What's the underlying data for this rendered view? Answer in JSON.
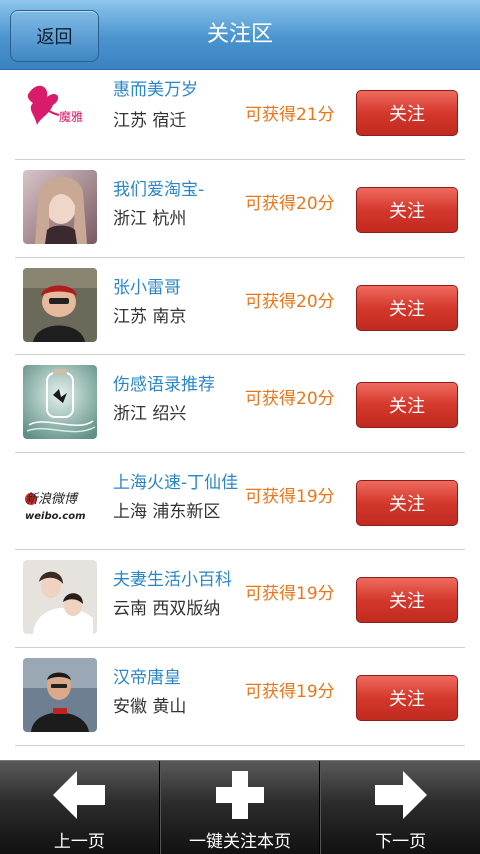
{
  "header": {
    "back_label": "返回",
    "title": "关注区"
  },
  "items": [
    {
      "name": "惠而美万岁",
      "location": "江苏 宿迁",
      "points": "可获得21分",
      "button": "关注",
      "avatar_logo": "魔雅"
    },
    {
      "name": "我们爱淘宝-",
      "location": "浙江 杭州",
      "points": "可获得20分",
      "button": "关注"
    },
    {
      "name": "张小雷哥",
      "location": "江苏 南京",
      "points": "可获得20分",
      "button": "关注"
    },
    {
      "name": "伤感语录推荐",
      "location": "浙江 绍兴",
      "points": "可获得20分",
      "button": "关注"
    },
    {
      "name": "上海火速-丁仙佳",
      "location": "上海 浦东新区",
      "points": "可获得19分",
      "button": "关注",
      "avatar_logo": "新浪微博",
      "avatar_logo_sub": "weibo.com"
    },
    {
      "name": "夫妻生活小百科",
      "location": "云南 西双版纳",
      "points": "可获得19分",
      "button": "关注"
    },
    {
      "name": "汉帝唐皇",
      "location": "安徽 黄山",
      "points": "可获得19分",
      "button": "关注"
    }
  ],
  "bottom": {
    "prev": "上一页",
    "follow_all": "一键关注本页",
    "next": "下一页"
  },
  "colors": {
    "header": "#4a94cf",
    "follow_button": "#d4382c",
    "name_text": "#2a86c4",
    "points_text": "#e8761b"
  },
  "icons": [
    "arrow-left-icon",
    "plus-icon",
    "arrow-right-icon"
  ]
}
